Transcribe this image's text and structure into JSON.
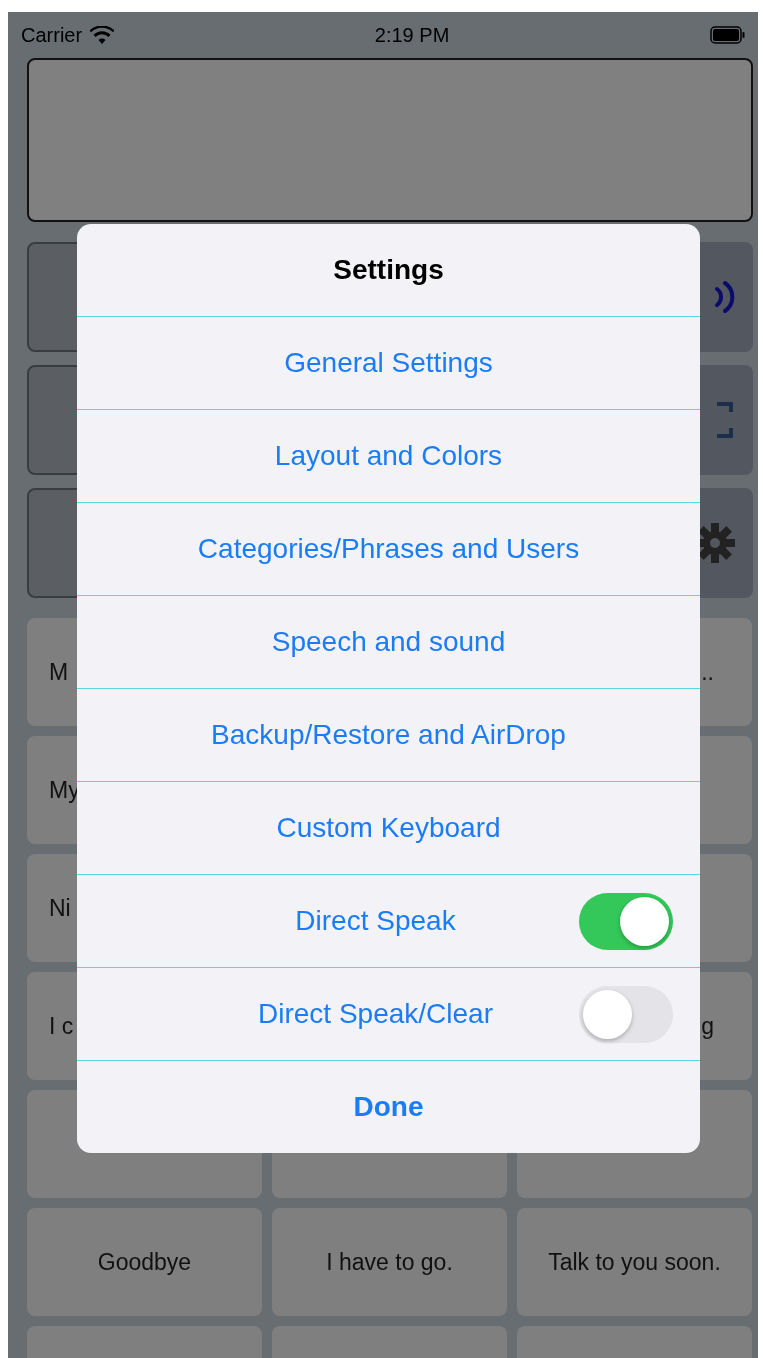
{
  "status_bar": {
    "carrier": "Carrier",
    "time": "2:19 PM"
  },
  "phrase_grid": {
    "rows": [
      [
        {
          "text": "M"
        },
        {},
        {
          "text": ".."
        }
      ],
      [
        {
          "text": "My"
        },
        {},
        {}
      ],
      [
        {
          "text": "Ni"
        },
        {},
        {}
      ],
      [
        {
          "text": "I c"
        },
        {},
        {
          "text": "g"
        }
      ],
      [
        {},
        {},
        {}
      ],
      [
        {
          "text": "Goodbye"
        },
        {
          "text": "I have to go."
        },
        {
          "text": "Talk to you soon."
        }
      ],
      [
        {},
        {},
        {}
      ]
    ]
  },
  "settings_dialog": {
    "title": "Settings",
    "items": [
      {
        "kind": "link",
        "label": "General Settings"
      },
      {
        "kind": "link",
        "label": "Layout and Colors"
      },
      {
        "kind": "link",
        "label": "Categories/Phrases and Users"
      },
      {
        "kind": "link",
        "label": "Speech and sound"
      },
      {
        "kind": "link",
        "label": "Backup/Restore and AirDrop"
      },
      {
        "kind": "link",
        "label": "Custom Keyboard"
      },
      {
        "kind": "toggle",
        "label": "Direct Speak",
        "on": true
      },
      {
        "kind": "toggle",
        "label": "Direct Speak/Clear",
        "on": false
      }
    ],
    "done": "Done"
  }
}
